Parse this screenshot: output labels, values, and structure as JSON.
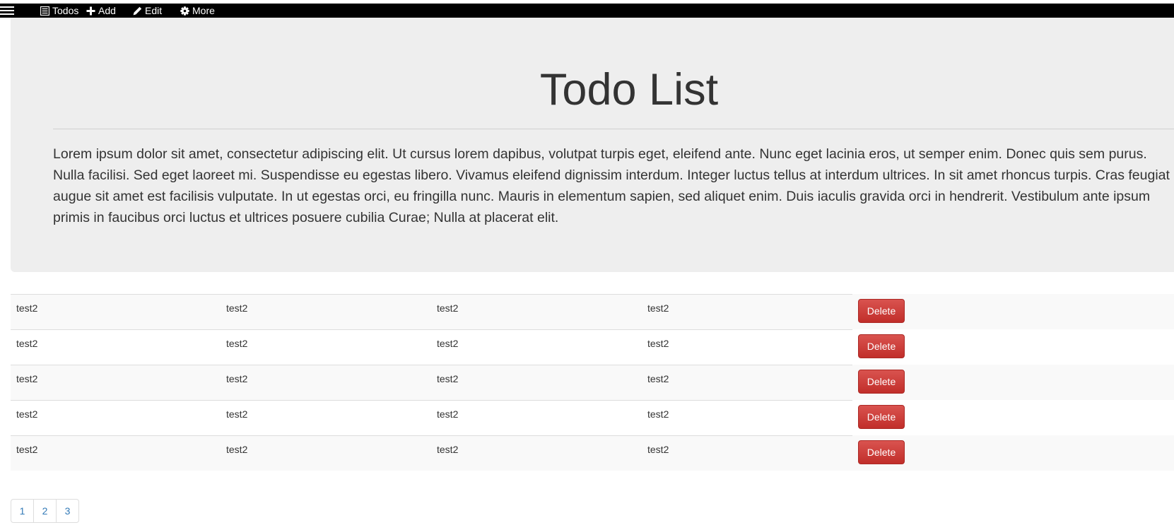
{
  "navbar": {
    "items": [
      {
        "label": "Todos",
        "icon": "list-icon"
      },
      {
        "label": "Add",
        "icon": "plus-icon"
      },
      {
        "label": "Edit",
        "icon": "pencil-icon"
      },
      {
        "label": "More",
        "icon": "gear-icon"
      }
    ]
  },
  "jumbotron": {
    "title": "Todo List",
    "text": "Lorem ipsum dolor sit amet, consectetur adipiscing elit. Ut cursus lorem dapibus, volutpat turpis eget, eleifend ante. Nunc eget lacinia eros, ut semper enim. Donec quis sem purus. Nulla facilisi. Sed eget laoreet mi. Suspendisse eu egestas libero. Vivamus eleifend dignissim interdum. Integer luctus tellus at interdum ultrices. In sit amet rhoncus turpis. Cras feugiat augue sit amet est facilisis vulputate. In ut egestas orci, eu fringilla nunc. Mauris in elementum sapien, sed aliquet enim. Duis iaculis gravida orci in hendrerit. Vestibulum ante ipsum primis in faucibus orci luctus et ultrices posuere cubilia Curae; Nulla at placerat elit."
  },
  "table": {
    "delete_label": "Delete",
    "rows": [
      [
        "test2",
        "test2",
        "test2",
        "test2"
      ],
      [
        "test2",
        "test2",
        "test2",
        "test2"
      ],
      [
        "test2",
        "test2",
        "test2",
        "test2"
      ],
      [
        "test2",
        "test2",
        "test2",
        "test2"
      ],
      [
        "test2",
        "test2",
        "test2",
        "test2"
      ]
    ]
  },
  "pagination": {
    "pages": [
      "1",
      "2",
      "3"
    ]
  },
  "colors": {
    "navbar_bg": "#000000",
    "jumbotron_bg": "#eeeeee",
    "delete_button": "#d9534f",
    "link": "#337ab7"
  }
}
